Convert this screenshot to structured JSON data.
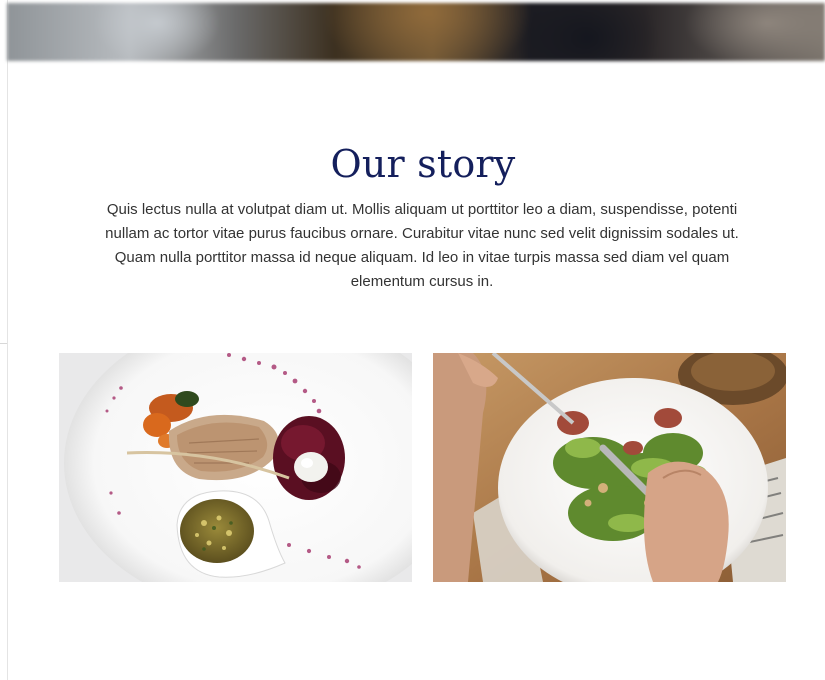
{
  "story": {
    "title": "Our story",
    "text": "Quis lectus nulla at volutpat diam ut. Mollis aliquam ut porttitor leo a diam, suspendisse, potenti nullam ac tortor vitae purus faucibus ornare. Curabitur vitae nunc sed velit dignissim sodales ut. Quam nulla porttitor massa id neque aliquam. Id leo in vitae turpis massa sed diam vel quam elementum cursus in."
  },
  "colors": {
    "title": "#141f5c",
    "body_text": "#333333",
    "background": "#ffffff"
  }
}
